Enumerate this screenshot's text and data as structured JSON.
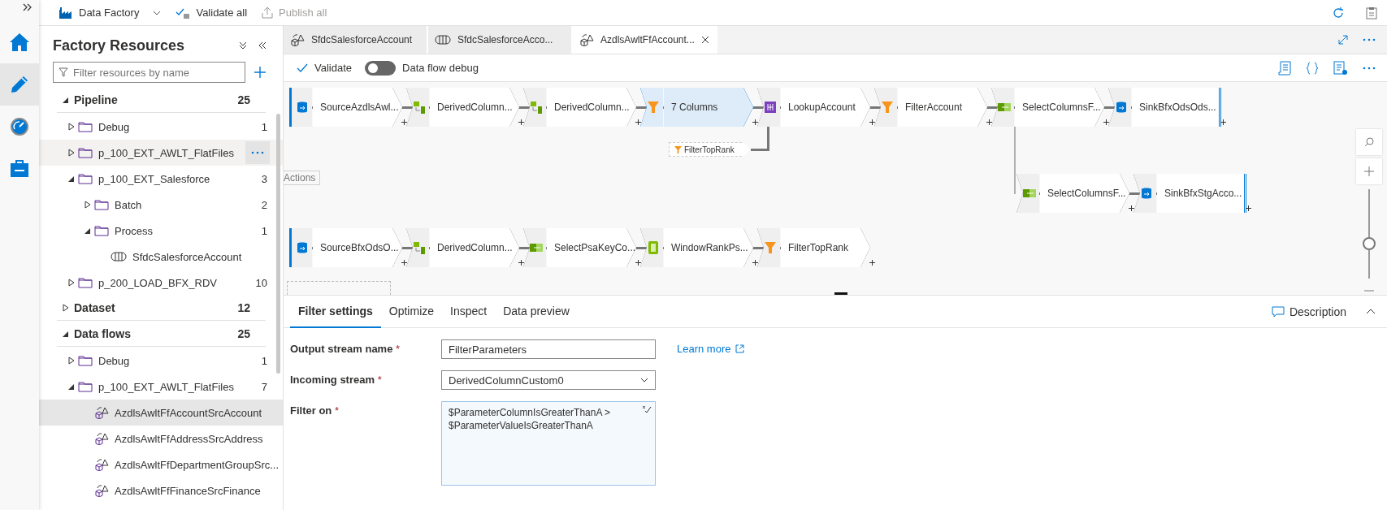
{
  "rail": {
    "items": [
      {
        "kind": "home",
        "selected": false
      },
      {
        "kind": "author",
        "selected": true
      },
      {
        "kind": "monitor",
        "selected": false
      },
      {
        "kind": "manage",
        "selected": false
      }
    ]
  },
  "top_bar": {
    "factory": "Data Factory",
    "validate_all": "Validate all",
    "publish_all": {
      "label": "Publish all",
      "disabled": true
    }
  },
  "resources": {
    "title": "Factory Resources",
    "search": {
      "placeholder": "Filter resources by name"
    },
    "tree": [
      {
        "label": "Pipeline",
        "kind": "category",
        "count": "25",
        "expanded": true,
        "selected": false,
        "hovered": false,
        "children": [
          {
            "label": "Debug",
            "kind": "folder",
            "count": "1",
            "expanded": false,
            "selected": false,
            "hovered": false
          },
          {
            "label": "p_100_EXT_AWLT_FlatFiles",
            "kind": "folder",
            "expanded": false,
            "selected": false,
            "hovered": true
          },
          {
            "label": "p_100_EXT_Salesforce",
            "kind": "folder",
            "count": "3",
            "expanded": true,
            "selected": false,
            "hovered": false,
            "children": [
              {
                "label": "Batch",
                "kind": "folder",
                "count": "2",
                "expanded": false,
                "selected": false,
                "hovered": false
              },
              {
                "label": "Process",
                "kind": "folder",
                "count": "1",
                "expanded": true,
                "selected": false,
                "hovered": false,
                "children": [
                  {
                    "label": "SfdcSalesforceAccount",
                    "kind": "pipeline",
                    "selected": false,
                    "hovered": false
                  }
                ]
              }
            ]
          },
          {
            "label": "p_200_LOAD_BFX_RDV",
            "kind": "folder",
            "count": "10",
            "expanded": false,
            "selected": false,
            "hovered": false
          }
        ]
      },
      {
        "label": "Dataset",
        "kind": "category",
        "count": "12",
        "expanded": false,
        "selected": false,
        "hovered": false
      },
      {
        "label": "Data flows",
        "kind": "category",
        "count": "25",
        "expanded": true,
        "selected": false,
        "hovered": false,
        "children": [
          {
            "label": "Debug",
            "kind": "folder",
            "count": "1",
            "expanded": false,
            "selected": false,
            "hovered": false
          },
          {
            "label": "p_100_EXT_AWLT_FlatFiles",
            "kind": "folder",
            "count": "7",
            "expanded": true,
            "selected": false,
            "hovered": false,
            "children": [
              {
                "label": "AzdlsAwltFfAccountSrcAccount",
                "kind": "dataflow",
                "selected": true,
                "hovered": false
              },
              {
                "label": "AzdlsAwltFfAddressSrcAddress",
                "kind": "dataflow",
                "selected": false,
                "hovered": false
              },
              {
                "label": "AzdlsAwltFfDepartmentGroupSrc...",
                "kind": "dataflow",
                "selected": false,
                "hovered": false
              },
              {
                "label": "AzdlsAwltFfFinanceSrcFinance",
                "kind": "dataflow",
                "selected": false,
                "hovered": false
              }
            ]
          }
        ]
      }
    ]
  },
  "tabs": [
    {
      "label": "SfdcSalesforceAccount",
      "kind": "dataflow",
      "selected": false
    },
    {
      "label": "SfdcSalesforceAcco...",
      "kind": "pipeline",
      "selected": false
    },
    {
      "label": "AzdlsAwltFfAccount...",
      "kind": "dataflow",
      "selected": true
    }
  ],
  "toolbar": {
    "validate": "Validate",
    "debug": {
      "label": "Data flow debug",
      "on": false
    }
  },
  "canvas": {
    "streams": [
      {
        "nodes": [
          {
            "label": "SourceAzdlsAwl...",
            "kind": "source",
            "selected": false
          },
          {
            "label": "DerivedColumn...",
            "kind": "derived",
            "selected": false
          },
          {
            "label": "DerivedColumn...",
            "kind": "derived",
            "selected": false
          },
          {
            "label": "7 Columns",
            "kind": "filter",
            "selected": true
          },
          {
            "label": "LookupAccount",
            "kind": "lookup",
            "selected": false
          },
          {
            "label": "FilterAccount",
            "kind": "filter",
            "selected": false
          },
          {
            "label": "SelectColumnsF...",
            "kind": "select",
            "selected": false
          },
          {
            "label": "SinkBfxOdsOds...",
            "kind": "sink",
            "selected": false
          }
        ]
      },
      {
        "nodes": [
          {
            "label": "SelectColumnsF...",
            "kind": "select",
            "selected": false
          },
          {
            "label": "SinkBfxStgAcco...",
            "kind": "sink",
            "selected": false
          }
        ]
      },
      {
        "nodes": [
          {
            "label": "SourceBfxOdsO...",
            "kind": "source",
            "selected": false
          },
          {
            "label": "DerivedColumn...",
            "kind": "derived",
            "selected": false
          },
          {
            "label": "SelectPsaKeyCo...",
            "kind": "select",
            "selected": false
          },
          {
            "label": "WindowRankPs...",
            "kind": "window",
            "selected": false
          },
          {
            "label": "FilterTopRank",
            "kind": "filter",
            "selected": false
          }
        ]
      }
    ],
    "reference": {
      "label": "FilterTopRank"
    },
    "tooltip": "Actions",
    "zoom": {
      "level": 0.38
    }
  },
  "settings": {
    "tabs": [
      {
        "label": "Filter settings",
        "selected": true
      },
      {
        "label": "Optimize",
        "selected": false
      },
      {
        "label": "Inspect",
        "selected": false
      },
      {
        "label": "Data preview",
        "selected": false
      }
    ],
    "description": "Description",
    "learn_more": "Learn more",
    "fields": [
      {
        "label": "Output stream name",
        "required": "*",
        "kind": "text",
        "value": "FilterParameters"
      },
      {
        "label": "Incoming stream",
        "required": "*",
        "kind": "select",
        "value": "DerivedColumnCustom0"
      },
      {
        "label": "Filter on",
        "required": "*",
        "kind": "expression",
        "value": "$ParameterColumnIsGreaterThanA >\n$ParameterValueIsGreaterThanA"
      }
    ]
  }
}
